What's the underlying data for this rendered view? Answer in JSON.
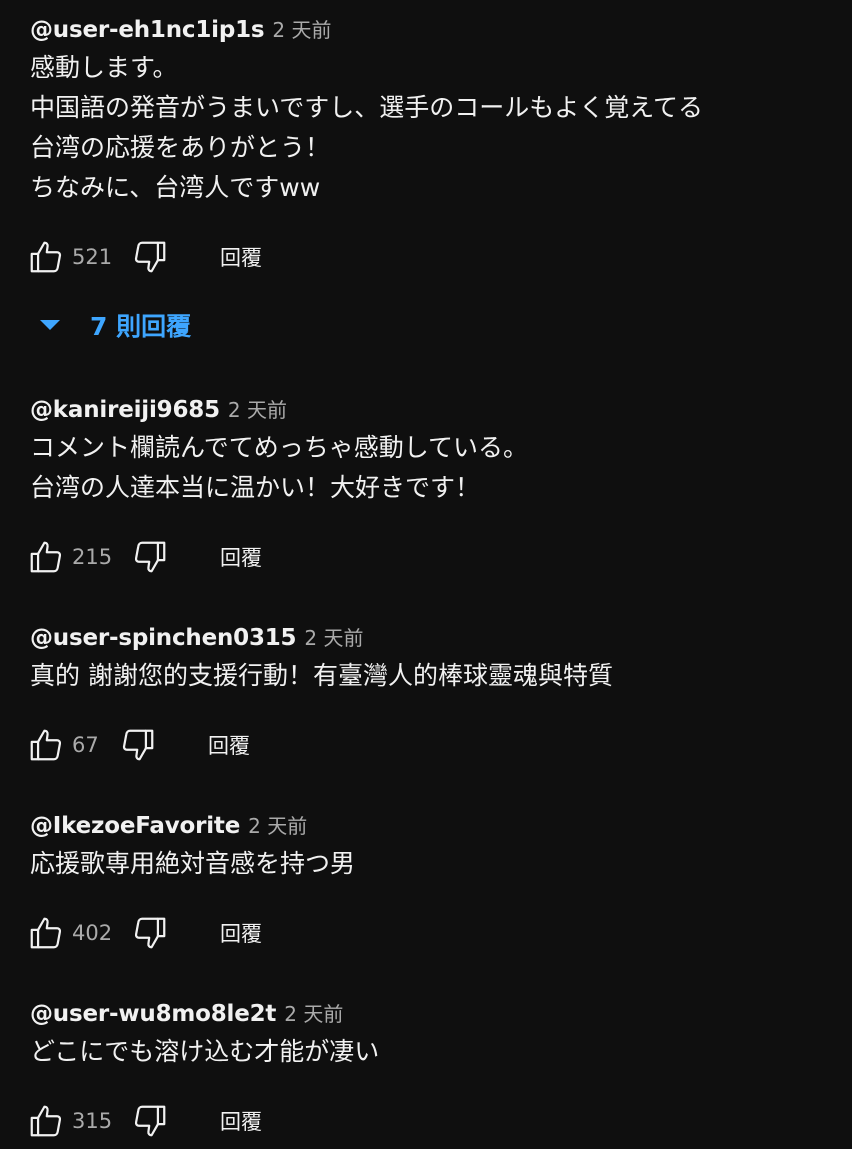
{
  "comments": [
    {
      "author": "@user-eh1nc1ip1s",
      "time": "2 天前",
      "lines": [
        "感動します。",
        "中国語の発音がうまいですし、選手のコールもよく覚えてる",
        "台湾の応援をありがとう！",
        "ちなみに、台湾人ですww"
      ],
      "likes": "521",
      "reply_label": "回覆",
      "replies_toggle": "7 則回覆"
    },
    {
      "author": "@kanireiji9685",
      "time": "2 天前",
      "lines": [
        "コメント欄読んでてめっちゃ感動している。",
        "台湾の人達本当に温かい！大好きです！"
      ],
      "likes": "215",
      "reply_label": "回覆"
    },
    {
      "author": "@user-spinchen0315",
      "time": "2 天前",
      "lines": [
        "真的 謝謝您的支援行動！有臺灣人的棒球靈魂與特質"
      ],
      "likes": "67",
      "reply_label": "回覆"
    },
    {
      "author": "@IkezoeFavorite",
      "time": "2 天前",
      "lines": [
        "応援歌専用絶対音感を持つ男"
      ],
      "likes": "402",
      "reply_label": "回覆"
    },
    {
      "author": "@user-wu8mo8le2t",
      "time": "2 天前",
      "lines": [
        "どこにでも溶け込む才能が凄い"
      ],
      "likes": "315",
      "reply_label": "回覆"
    }
  ],
  "icons": {
    "like": "thumbs-up-icon",
    "dislike": "thumbs-down-icon",
    "expand": "triangle-down-icon"
  },
  "colors": {
    "background": "#0f0f0f",
    "text": "#f1f1f1",
    "secondary": "#aaaaaa",
    "link": "#3ea6ff"
  }
}
